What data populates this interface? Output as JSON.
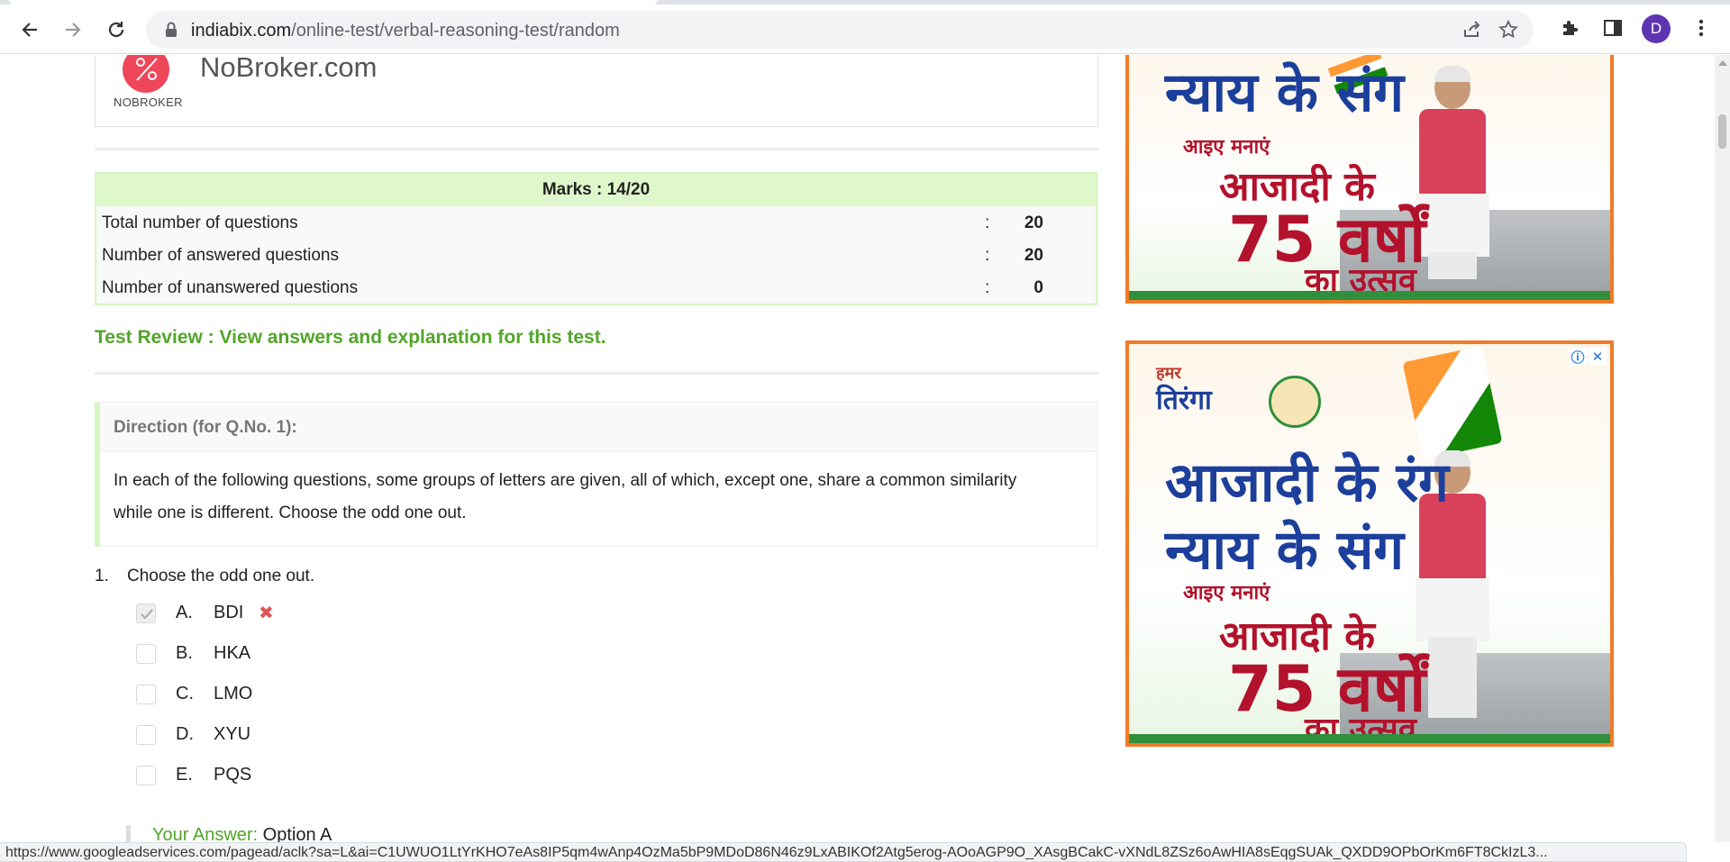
{
  "browser": {
    "url_domain": "indiabix.com",
    "url_path": "/online-test/verbal-reasoning-test/random",
    "profile_initial": "D"
  },
  "brand": {
    "name": "NoBroker.com",
    "logo_caption": "NOBROKER"
  },
  "marks": {
    "header": "Marks : 14/20",
    "rows": [
      {
        "label": "Total number of questions",
        "sep": ":",
        "value": "20"
      },
      {
        "label": "Number of answered questions",
        "sep": ":",
        "value": "20"
      },
      {
        "label": "Number of unanswered questions",
        "sep": ":",
        "value": "0"
      }
    ]
  },
  "review_link": "Test Review : View answers and explanation for this test.",
  "direction": {
    "heading": "Direction (for Q.No. 1):",
    "body": "In each of the following questions, some groups of letters are given, all of which, except one, share a common similarity while one is different. Choose the odd one out."
  },
  "question": {
    "number": "1.",
    "text": "Choose the odd one out.",
    "options": [
      {
        "letter": "A.",
        "text": "BDI",
        "checked": true,
        "wrong_mark": "✖"
      },
      {
        "letter": "B.",
        "text": "HKA",
        "checked": false
      },
      {
        "letter": "C.",
        "text": "LMO",
        "checked": false
      },
      {
        "letter": "D.",
        "text": "XYU",
        "checked": false
      },
      {
        "letter": "E.",
        "text": "PQS",
        "checked": false
      }
    ],
    "your_answer_label": "Your Answer:",
    "your_answer_value": "Option A"
  },
  "ads": {
    "ad1": {
      "line1": "न्याय के संग",
      "line2": "आइए मनाएं",
      "line3": "आजादी के",
      "line4": "75 वर्षों",
      "line5": "का उत्सव"
    },
    "ad2": {
      "hamar": "हमर",
      "tiranga": "तिरंगा",
      "line0": "आजादी के रंग",
      "line1": "न्याय के संग",
      "line2": "आइए मनाएं",
      "line3": "आजादी के",
      "line4": "75 वर्षों",
      "line5": "का उत्सव",
      "adchoices_info": "ⓘ",
      "adchoices_close": "✕"
    }
  },
  "status_bar": "https://www.googleadservices.com/pagead/aclk?sa=L&ai=C1UWUO1LtYrKHO7eAs8IP5qm4wAnp4OzMa5bP9MDoD86N46z9LxABIKOf2Atg5erog-AOoAGP9O_XAsgBCakC-vXNdL8ZSz6oAwHIA8sEqgSUAk_QXDD9OPbOrKm6FT8CkIzL3..."
}
